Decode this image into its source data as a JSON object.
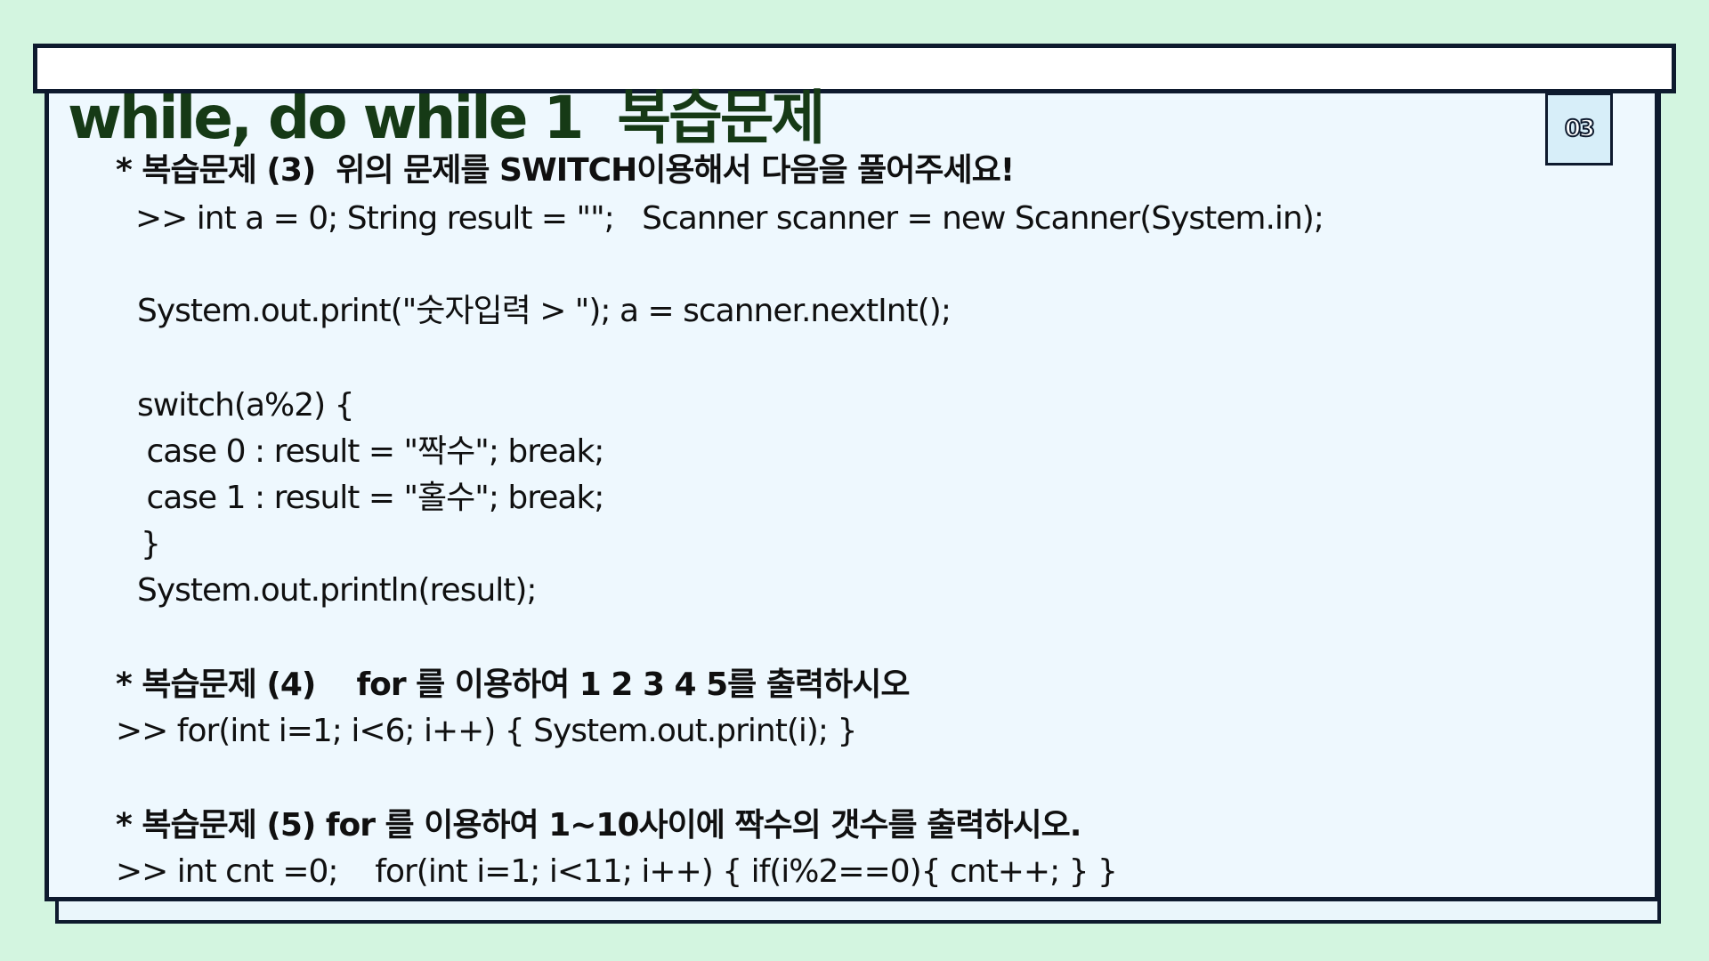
{
  "slide": {
    "title": "while, do while 1  복습문제",
    "page_number": "03"
  },
  "content": {
    "q3_heading": "* 복습문제 (3)  위의 문제를 SWITCH이용해서 다음을 풀어주세요!",
    "q3_line1": ">> int a = 0; String result = \"\";   Scanner scanner = new Scanner(System.in);",
    "q3_line2": "System.out.print(\"숫자입력 > \"); a = scanner.nextInt();",
    "q3_line3": "switch(a%2) {",
    "q3_line4": " case 0 : result = \"짝수\"; break;",
    "q3_line5": " case 1 : result = \"홀수\"; break;",
    "q3_line6": "}",
    "q3_line7": "System.out.println(result);",
    "q4_heading": "* 복습문제 (4)    for 를 이용하여 1 2 3 4 5를 출력하시오",
    "q4_answer": ">> for(int i=1; i<6; i++) { System.out.print(i); }",
    "q5_heading": "* 복습문제 (5) for 를 이용하여 1~10사이에 짝수의 갯수를 출력하시오.",
    "q5_answer": ">> int cnt =0;    for(int i=1; i<11; i++) { if(i%2==0){ cnt++; } }"
  }
}
